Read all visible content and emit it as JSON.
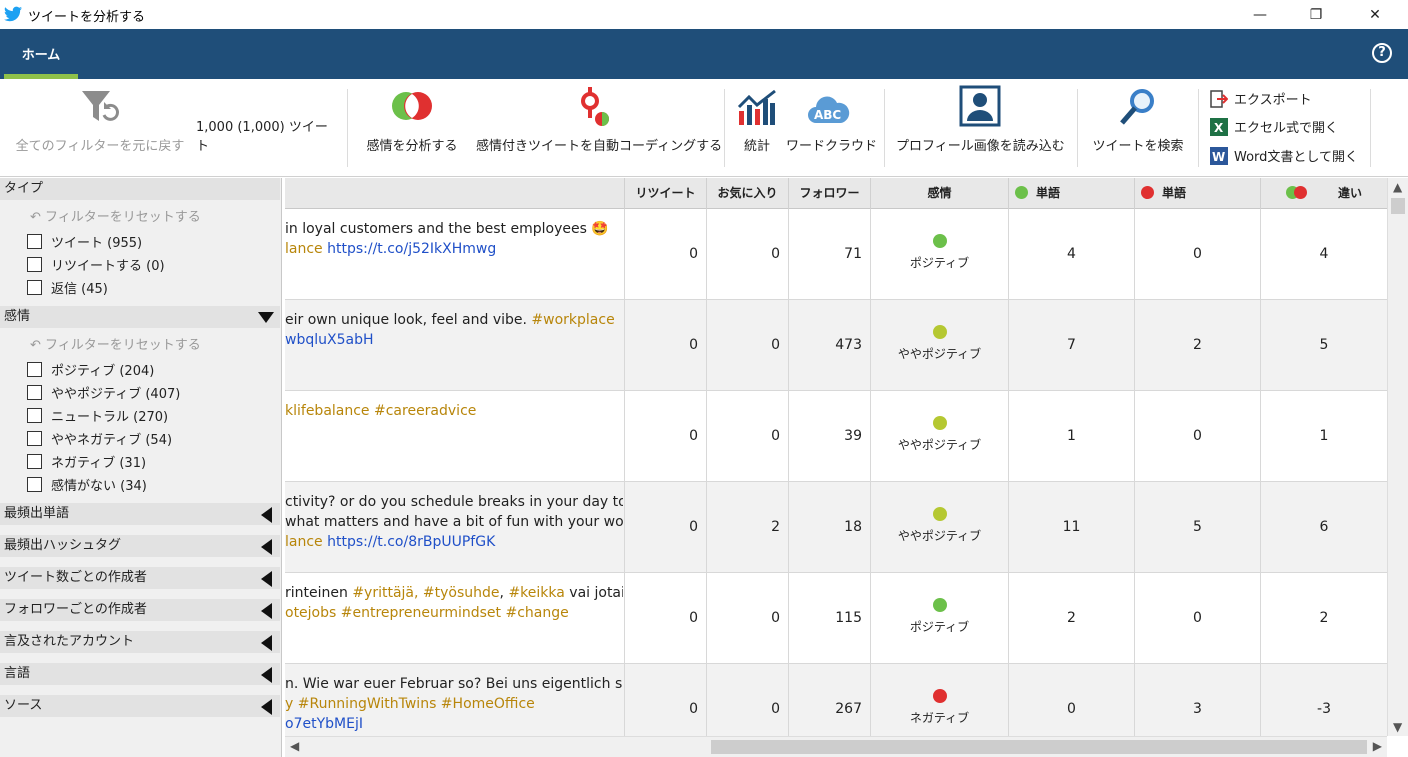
{
  "window": {
    "title": "ツイートを分析する",
    "min": "—",
    "max": "❐",
    "close": "✕"
  },
  "ribbon": {
    "tab": "ホーム",
    "help": "?"
  },
  "toolbar": {
    "reset_filters": "全てのフィルターを元に戻す",
    "tweet_count": "1,000 (1,000) ツイート",
    "analyze_sentiment": "感情を分析する",
    "autocode": "感情付きツイートを自動コーディングする",
    "stats": "統計",
    "wordcloud": "ワードクラウド",
    "profile_images": "プロフィール画像を読み込む",
    "search": "ツイートを検索",
    "export": "エクスポート",
    "excel": "エクセル式で開く",
    "word": "Word文書として開く",
    "colors": {
      "green": "#6cc04a",
      "red": "#e03030",
      "blue": "#1f4e79"
    }
  },
  "sidebar": {
    "type_header": "タイプ",
    "reset": "フィルターをリセットする",
    "type_items": [
      "ツイート (955)",
      "リツイートする (0)",
      "返信 (45)"
    ],
    "sentiment_header": "感情",
    "sentiment_items": [
      "ポジティブ (204)",
      "ややポジティブ (407)",
      "ニュートラル (270)",
      "ややネガティブ (54)",
      "ネガティブ (31)",
      "感情がない (34)"
    ],
    "collapsed": [
      "最頻出単語",
      "最頻出ハッシュタグ",
      "ツイート数ごとの作成者",
      "フォロワーごとの作成者",
      "言及されたアカウント",
      "言語",
      "ソース"
    ]
  },
  "grid": {
    "headers": {
      "retweets": "リツイート",
      "favorites": "お気に入り",
      "followers": "フォロワー",
      "sentiment": "感情",
      "pos_words": "単語",
      "neg_words": "単語",
      "diff": "違い"
    },
    "rows": [
      {
        "l1": "in loyal customers and the best employees 🤩",
        "l2a": "lance",
        "l2b": " https://t.co/j52IkXHmwg",
        "l3": "",
        "rt": "0",
        "fav": "0",
        "fol": "71",
        "sent": "ポジティブ",
        "color": "#6cc04a",
        "pos": "4",
        "neg": "0",
        "diff": "4"
      },
      {
        "l1a": "eir own unique look, feel and vibe. ",
        "l1b": "#workplace",
        "l2": "wbqluX5abH",
        "rt": "0",
        "fav": "0",
        "fol": "473",
        "sent": "ややポジティブ",
        "color": "#b5c832",
        "pos": "7",
        "neg": "2",
        "diff": "5"
      },
      {
        "l1": "klifebalance #careeradvice",
        "rt": "0",
        "fav": "0",
        "fol": "39",
        "sent": "ややポジティブ",
        "color": "#b5c832",
        "pos": "1",
        "neg": "0",
        "diff": "1"
      },
      {
        "l1": "ctivity? or do you schedule breaks in your day to",
        "l2": "what matters and have a bit of fun with your work",
        "l3a": "lance",
        "l3b": " https://t.co/8rBpUUPfGK",
        "rt": "0",
        "fav": "2",
        "fol": "18",
        "sent": "ややポジティブ",
        "color": "#b5c832",
        "pos": "11",
        "neg": "5",
        "diff": "6"
      },
      {
        "l1a": "rinteinen ",
        "l1b": "#yrittäjä, #työsuhde",
        "l1c": ", ",
        "l1d": "#keikka",
        "l1e": " vai jotain",
        "l2": "otejobs #entrepreneurmindset #change",
        "rt": "0",
        "fav": "0",
        "fol": "115",
        "sent": "ポジティブ",
        "color": "#6cc04a",
        "pos": "2",
        "neg": "0",
        "diff": "2"
      },
      {
        "l1": "n. Wie war euer Februar so? Bei uns eigentlich so",
        "l2": "y #RunningWithTwins #HomeOffice",
        "l3": "o7etYbMEjI",
        "rt": "0",
        "fav": "0",
        "fol": "267",
        "sent": "ネガティブ",
        "color": "#e03030",
        "pos": "0",
        "neg": "3",
        "diff": "-3"
      }
    ]
  }
}
